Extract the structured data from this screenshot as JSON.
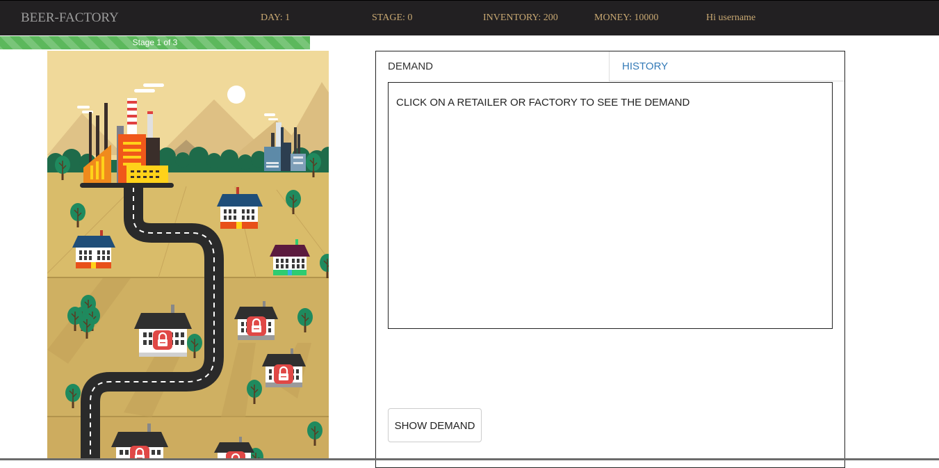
{
  "navbar": {
    "brand": "BEER-FACTORY",
    "day": "DAY: 1",
    "stage": "STAGE: 0",
    "inventory": "INVENTORY: 200",
    "money": "MONEY: 10000",
    "greeting": "Hi username"
  },
  "progress": {
    "label": "Stage 1 of 3",
    "fraction": 0.333
  },
  "panel": {
    "tabs": [
      {
        "label": "DEMAND",
        "active": true
      },
      {
        "label": "HISTORY",
        "active": false
      }
    ],
    "demand_message": "CLICK ON A RETAILER OR FACTORY TO SEE THE DEMAND",
    "show_button": "SHOW DEMAND"
  },
  "map": {
    "nodes": [
      {
        "name": "factory-main",
        "locked": false
      },
      {
        "name": "factory-distant",
        "locked": false
      },
      {
        "name": "retailer-1",
        "locked": false
      },
      {
        "name": "retailer-2",
        "locked": false
      },
      {
        "name": "retailer-3",
        "locked": false
      },
      {
        "name": "retailer-4",
        "locked": true
      },
      {
        "name": "retailer-5",
        "locked": true
      },
      {
        "name": "retailer-6",
        "locked": true
      },
      {
        "name": "retailer-7",
        "locked": true
      },
      {
        "name": "retailer-8",
        "locked": true
      }
    ]
  },
  "colors": {
    "navbar": "#222022",
    "stat_text": "#c8a872",
    "brand_text": "#9d9d9d",
    "progress": "#5cb85c",
    "tab_link": "#337ab7",
    "map_sky": "#f0d99a",
    "map_ground": "#d7b967"
  }
}
